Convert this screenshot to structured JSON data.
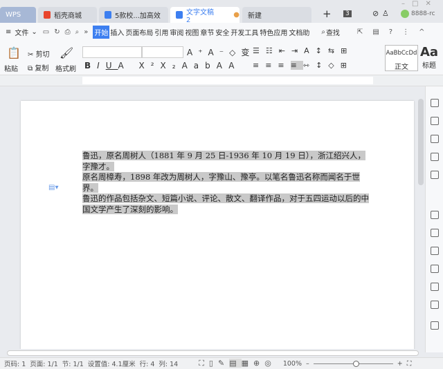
{
  "tabs": [
    {
      "label": "WPS"
    },
    {
      "label": "稻壳商城"
    },
    {
      "label": "5款校...加高效"
    },
    {
      "label": "文字文稿2",
      "active": true
    },
    {
      "label": "新建"
    }
  ],
  "titlebar": {
    "tab_count": "3",
    "user": "8888-rc"
  },
  "menu": {
    "file": "文件",
    "items": [
      "开始",
      "插入",
      "页面布局",
      "引用",
      "审阅",
      "视图",
      "章节",
      "安全",
      "开发工具",
      "特色应用",
      "文档助"
    ],
    "search": "查找"
  },
  "ribbon": {
    "paste": "粘贴",
    "cut": "剪切",
    "copy": "复制",
    "format_painter": "格式刷",
    "style_normal_preview": "AaBbCcDd",
    "style_normal": "正文",
    "style_heading_preview": "Aa",
    "style_heading": "标题"
  },
  "document": {
    "lines": [
      "鲁迅，原名周树人（1881 年 9 月 25 日-1936 年 10 月 19 日），浙江绍兴人，字豫才。",
      "原名周樟寿，1898 年改为周树人，字豫山、豫亭。以笔名鲁迅名称而闻名于世界。",
      "鲁迅的作品包括杂文、短篇小说、评论、散文、翻译作品，对于五四运动以后的中",
      "国文学产生了深刻的影响。"
    ]
  },
  "status": {
    "page_num": "页码: 1",
    "pages": "页面: 1/1",
    "section": "节: 1/1",
    "setting": "设置值: 4.1厘米",
    "row": "行: 4",
    "col": "列: 14",
    "zoom": "100%"
  },
  "colors": {
    "accent": "#3d7ff0",
    "wps_tab": "#a7b8d6",
    "selection": "#c9c9c9"
  }
}
